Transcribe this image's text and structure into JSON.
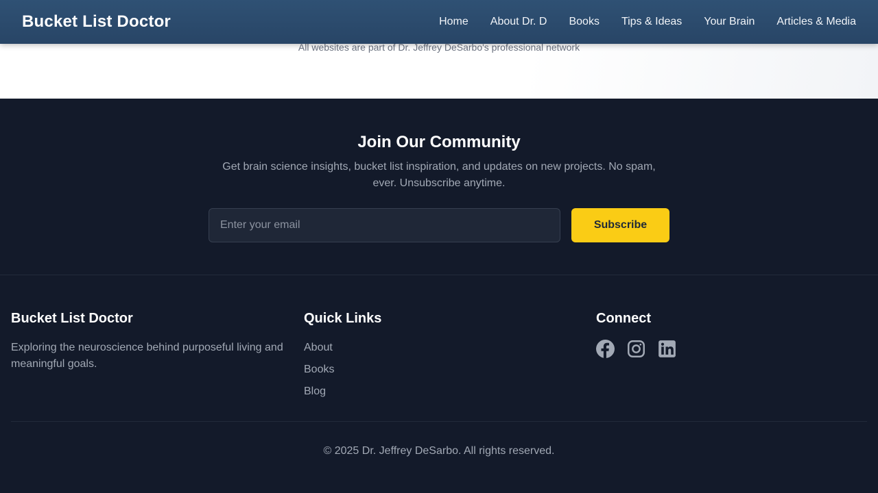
{
  "header": {
    "brand": "Bucket List Doctor",
    "nav": [
      "Home",
      "About Dr. D",
      "Books",
      "Tips & Ideas",
      "Your Brain",
      "Articles & Media"
    ]
  },
  "network_note": "All websites are part of Dr. Jeffrey DeSarbo's professional network",
  "newsletter": {
    "title": "Join Our Community",
    "description": "Get brain science insights, bucket list inspiration, and updates on new projects. No spam, ever. Unsubscribe anytime.",
    "email_placeholder": "Enter your email",
    "email_value": "",
    "button_label": "Subscribe"
  },
  "footer": {
    "about": {
      "title": "Bucket List Doctor",
      "text": "Exploring the neuroscience behind purposeful living and meaningful goals."
    },
    "quick_links": {
      "title": "Quick Links",
      "items": [
        "About",
        "Books",
        "Blog"
      ]
    },
    "connect": {
      "title": "Connect",
      "icons": [
        "facebook-icon",
        "instagram-icon",
        "linkedin-icon"
      ]
    },
    "copyright": "© 2025 Dr. Jeffrey DeSarbo. All rights reserved."
  },
  "colors": {
    "nav_bg": "#2f5174",
    "footer_bg": "#131a2a",
    "accent": "#facc15",
    "muted_text": "#a2a9b5"
  }
}
